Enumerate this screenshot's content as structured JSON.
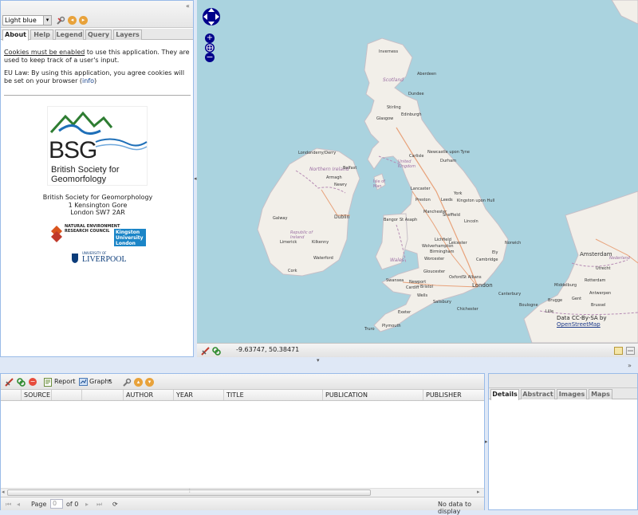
{
  "left_toolbar": {
    "theme_value": "Light blue",
    "collapse_glyph": "«"
  },
  "tabs": [
    "About",
    "Help",
    "Legend",
    "Query",
    "Layers"
  ],
  "about": {
    "cookies_link": "Cookies must be enabled",
    "cookies_text": " to use this application. They are used to keep track of a user's input.",
    "eu_law": "EU Law: By using this application, you agree cookies will be set on your browser (",
    "info_link": "info",
    "eu_law_end": ")"
  },
  "bsg_logo": {
    "letters": "BSG",
    "line1": "British Society for",
    "line2": "Geomorfology"
  },
  "address": {
    "line1": "British Society for Geomorphology",
    "line2": "1 Kensington Gore",
    "line3": "London SW7 2AR"
  },
  "partners": {
    "nerc": "NATURAL ENVIRONMENT RESEARCH COUNCIL",
    "kingston": "Kingston University London",
    "liverpool_small": "UNIVERSITY OF",
    "liverpool": "LIVERPOOL"
  },
  "map": {
    "coords": "-9.63747, 50.38471",
    "attribution_prefix": "Data CC-By-SA by ",
    "attribution_link": "OpenStreetMap",
    "labels": {
      "inverness": "Inverness",
      "scotland": "Scotland",
      "aberdeen": "Aberdeen",
      "dundee": "Dundee",
      "stirling": "Stirling",
      "edinburgh": "Edinburgh",
      "glasgow": "Glasgow",
      "newcastle": "Newcastle upon Tyne",
      "carlisle": "Carlisle",
      "londonderry": "Londonderry/Derry",
      "northern_ireland": "Northern Ireland",
      "belfast": "Belfast",
      "armagh": "Armagh",
      "newry": "Newry",
      "isle_of_man": "Isle of Man",
      "united_kingdom": "United Kingdom",
      "durham": "Durham",
      "lancaster": "Lancaster",
      "york": "York",
      "preston": "Preston",
      "leeds": "Leeds",
      "kingston": "Kingston upon Hull",
      "manchester": "Manchester",
      "sheffield": "Sheffield",
      "galway": "Galway",
      "dublin": "Dublin",
      "republic_of_ireland": "Republic of Ireland",
      "ireland": "Ireland",
      "limerick": "Limerick",
      "kilkenny": "Kilkenny",
      "waterford": "Waterford",
      "cork": "Cork",
      "bangor": "Bangor",
      "st_asaph": "St Asaph",
      "lincoln": "Lincoln",
      "lichfield": "Lichfield",
      "leicester": "Leicester",
      "norwich": "Norwich",
      "wolverhampton": "Wolverhampton",
      "birmingham": "Birmingham",
      "wales": "Wales",
      "worcester": "Worcester",
      "cambridge": "Cambridge",
      "ely": "Ely",
      "gloucester": "Gloucester",
      "oxford": "Oxford",
      "st_albans": "St Albans",
      "swansea": "Swansea",
      "newport": "Newport",
      "cardiff": "Cardiff",
      "bristol": "Bristol",
      "london": "London",
      "wells": "Wells",
      "salisbury": "Salisbury",
      "canterbury": "Canterbury",
      "chichester": "Chichester",
      "exeter": "Exeter",
      "truro": "Truro",
      "plymouth": "Plymouth",
      "amsterdam": "Amsterdam",
      "nederland": "Nederland",
      "utrecht": "Utrecht",
      "middelburg": "Middelburg",
      "rotterdam": "Rotterdam",
      "antwerpen": "Antwerpen",
      "gent": "Gent",
      "brugge": "Brugge",
      "brussel": "Brussel",
      "lille": "Lille",
      "boulogne": "Boulogne"
    }
  },
  "grid": {
    "report_label": "Report",
    "graphs_label": "Graphs",
    "columns": [
      "SOURCE",
      "",
      "",
      "AUTHOR",
      "YEAR",
      "TITLE",
      "PUBLICATION",
      "PUBLISHER"
    ],
    "pager": {
      "page_label": "Page",
      "page_value": "0",
      "of_label": "of 0",
      "status": "No data to display"
    }
  },
  "details": {
    "tabs": [
      "Details",
      "Abstract",
      "Images",
      "Maps"
    ],
    "collapse_glyph": "»"
  },
  "colors": {
    "panel_border": "#99bbe8",
    "sea": "#aad3df",
    "land": "#f2efe9",
    "background": "#dfe8f6"
  }
}
